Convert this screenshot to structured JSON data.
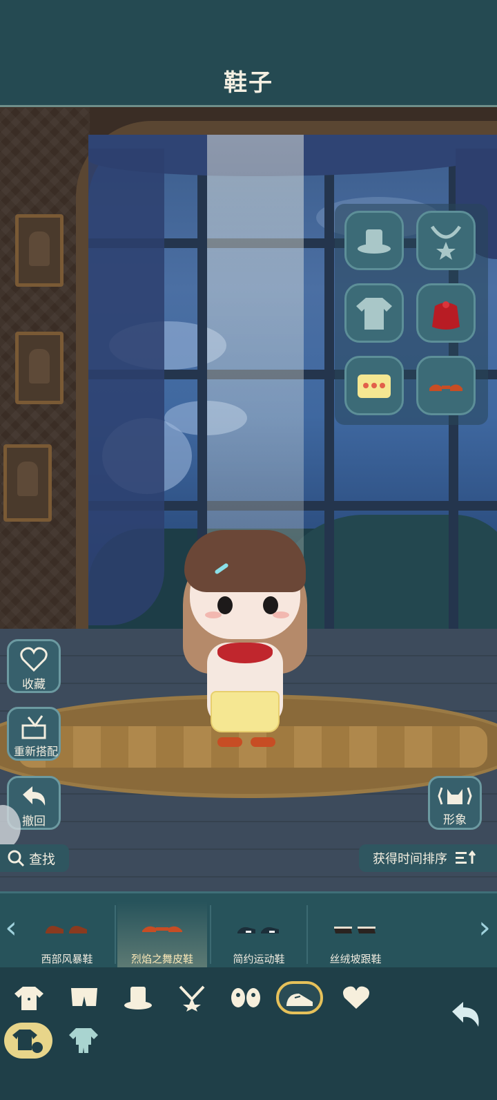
{
  "header": {
    "title": "鞋子"
  },
  "side_buttons": {
    "favorite": "收藏",
    "rematch": "重新搭配",
    "undo": "撤回",
    "appearance": "形象"
  },
  "toolbar": {
    "search": "查找",
    "sort": "获得时间排序"
  },
  "items": [
    {
      "label": "西部风暴鞋",
      "color": "#8a3a1f",
      "selected": false
    },
    {
      "label": "烈焰之舞皮鞋",
      "color": "#c74d24",
      "selected": true
    },
    {
      "label": "简约运动鞋",
      "color": "#1c2f3a",
      "selected": false
    },
    {
      "label": "丝绒坡跟鞋",
      "color": "#2a2320",
      "selected": false
    }
  ],
  "equipped_slots": [
    "hat-icon",
    "necklace-icon",
    "shirt-icon",
    "bag-icon",
    "skirt-icon",
    "shoes-icon"
  ],
  "categories": [
    "shirt-icon",
    "pants-icon",
    "hat-icon",
    "necklace-icon",
    "wings-icon",
    "shoes-icon",
    "heart-icon"
  ],
  "active_category": "shoes-icon",
  "colors": {
    "accent": "#e6c15a",
    "panel": "#37606c",
    "text": "#f3eee0"
  }
}
